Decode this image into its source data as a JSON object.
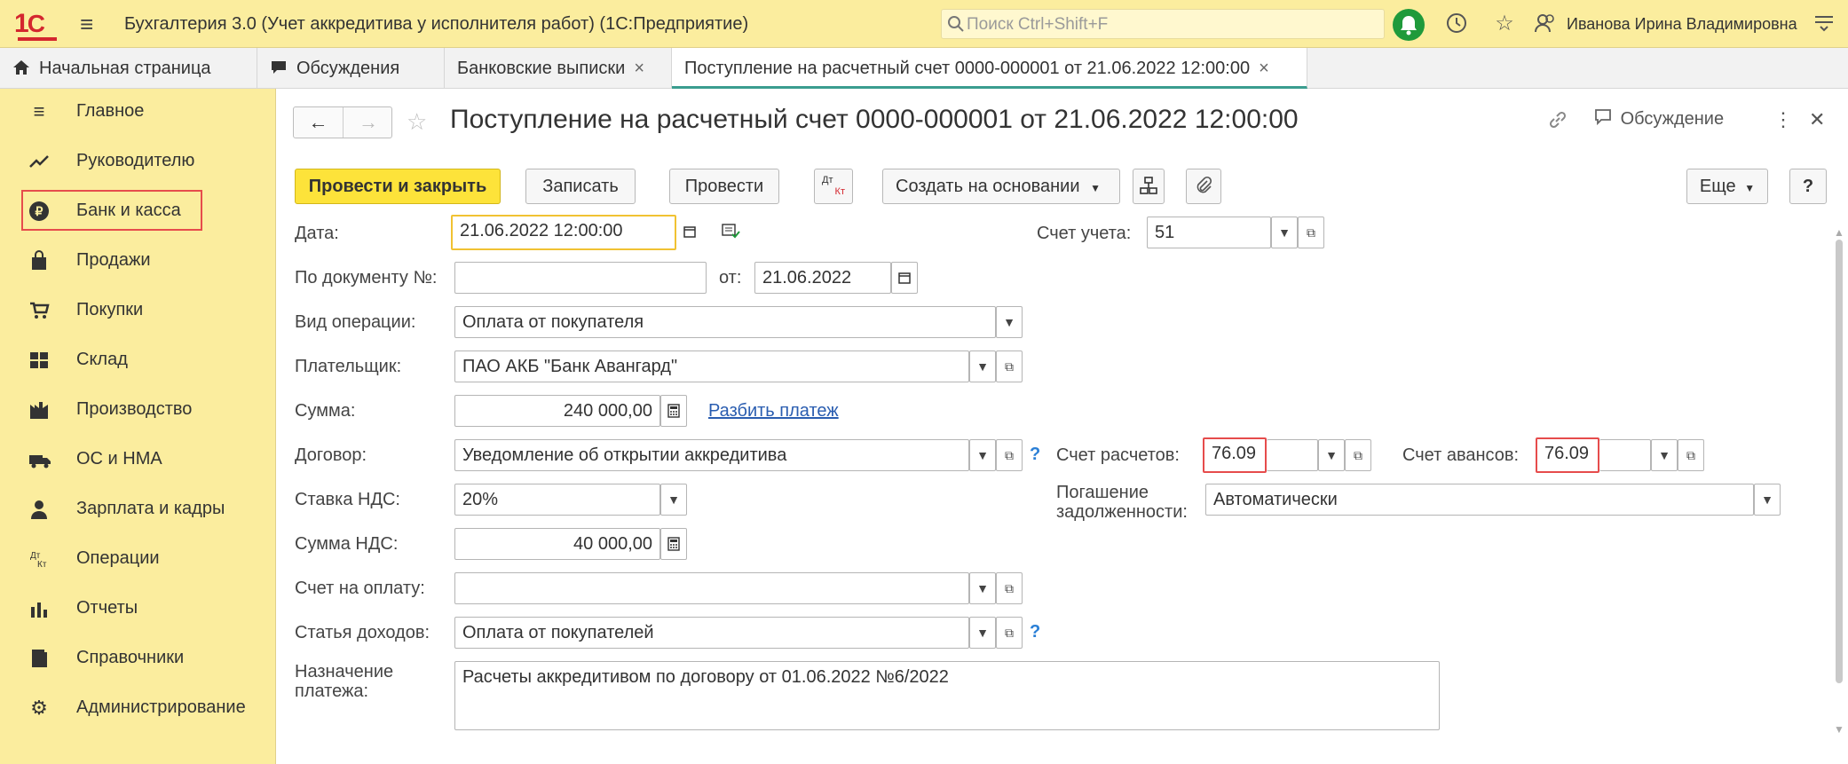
{
  "app": {
    "title": "Бухгалтерия 3.0 (Учет аккредитива у исполнителя работ)  (1С:Предприятие)",
    "search_placeholder": "Поиск Ctrl+Shift+F",
    "username": "Иванова Ирина Владимировна",
    "logo_text": "1С"
  },
  "tabs": [
    {
      "label": "Начальная страница",
      "icon": "home-icon"
    },
    {
      "label": "Обсуждения",
      "icon": "chat-icon"
    },
    {
      "label": "Банковские выписки",
      "close": "×"
    },
    {
      "label": "Поступление на расчетный счет 0000-000001 от 21.06.2022 12:00:00",
      "close": "×"
    }
  ],
  "sidebar": {
    "items": [
      {
        "label": "Главное",
        "icon": "menu-icon"
      },
      {
        "label": "Руководителю",
        "icon": "trend-icon"
      },
      {
        "label": "Банк и касса",
        "icon": "ruble-icon"
      },
      {
        "label": "Продажи",
        "icon": "bag-icon"
      },
      {
        "label": "Покупки",
        "icon": "cart-icon"
      },
      {
        "label": "Склад",
        "icon": "warehouse-icon"
      },
      {
        "label": "Производство",
        "icon": "factory-icon"
      },
      {
        "label": "ОС и НМА",
        "icon": "truck-icon"
      },
      {
        "label": "Зарплата и кадры",
        "icon": "person-icon"
      },
      {
        "label": "Операции",
        "icon": "dt-kt-icon"
      },
      {
        "label": "Отчеты",
        "icon": "bar-chart-icon"
      },
      {
        "label": "Справочники",
        "icon": "book-icon"
      },
      {
        "label": "Администрирование",
        "icon": "gear-icon"
      }
    ]
  },
  "document": {
    "title": "Поступление на расчетный счет 0000-000001 от 21.06.2022 12:00:00",
    "discussion_label": "Обсуждение"
  },
  "toolbar": {
    "post_close": "Провести и закрыть",
    "save": "Записать",
    "post": "Провести",
    "dtkt": "Дт Кт",
    "create_based": "Создать на основании",
    "more": "Еще",
    "help": "?"
  },
  "form": {
    "date_label": "Дата:",
    "date_value": "21.06.2022 12:00:00",
    "account_label": "Счет учета:",
    "account_value": "51",
    "docnum_label": "По документу №:",
    "docnum_value": "",
    "from_label": "от:",
    "from_value": "21.06.2022",
    "optype_label": "Вид операции:",
    "optype_value": "Оплата от покупателя",
    "payer_label": "Плательщик:",
    "payer_value": "ПАО АКБ \"Банк Авангард\"",
    "sum_label": "Сумма:",
    "sum_value": "240 000,00",
    "split_link": "Разбить платеж",
    "contract_label": "Договор:",
    "contract_value": "Уведомление об открытии аккредитива",
    "settle_label": "Счет расчетов:",
    "settle_value": "76.09",
    "advance_label": "Счет авансов:",
    "advance_value": "76.09",
    "vat_rate_label": "Ставка НДС:",
    "vat_rate_value": "20%",
    "repay_label_1": "Погашение",
    "repay_label_2": "задолженности:",
    "repay_value": "Автоматически",
    "vat_sum_label": "Сумма НДС:",
    "vat_sum_value": "40 000,00",
    "invoice_label": "Счет на оплату:",
    "invoice_value": "",
    "income_label": "Статья доходов:",
    "income_value": "Оплата от покупателей",
    "purpose_label_1": "Назначение",
    "purpose_label_2": "платежа:",
    "purpose_value": "Расчеты аккредитивом по договору от 01.06.2022 №6/2022",
    "help_mark": "?"
  },
  "colors": {
    "sidebar_bg": "#fbed9e",
    "primary_button": "#fde33a",
    "highlight_red": "#e64c4c",
    "focus_yellow": "#f1c232",
    "link_blue": "#2a5db0"
  }
}
